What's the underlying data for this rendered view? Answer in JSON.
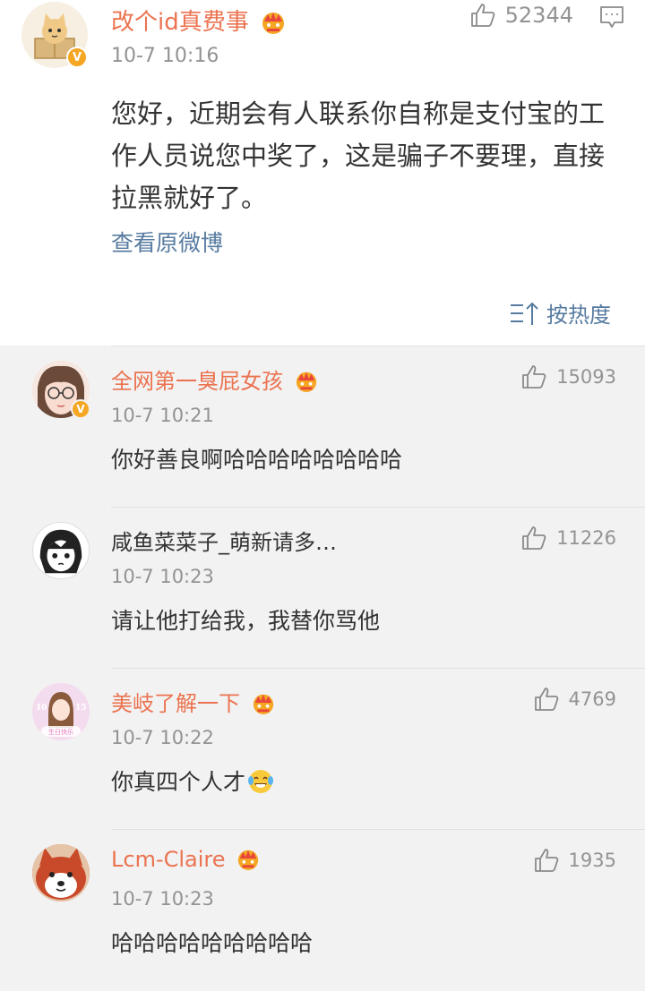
{
  "main_post": {
    "username": "改个id真费事",
    "time": "10-7 10:16",
    "likes": "52344",
    "text": "您好，近期会有人联系你自称是支付宝的工作人员说您中奖了，这是骗子不要理，直接拉黑就好了。",
    "view_original": "查看原微博",
    "sort_label": "按热度"
  },
  "comments": [
    {
      "username": "全网第一臭屁女孩",
      "time": "10-7 10:21",
      "likes": "15093",
      "text": "你好善良啊哈哈哈哈哈哈哈哈"
    },
    {
      "username": "咸鱼菜菜子_萌新请多…",
      "time": "10-7 10:23",
      "likes": "11226",
      "text": "请让他打给我，我替你骂他"
    },
    {
      "username": "美岐了解一下",
      "time": "10-7 10:22",
      "likes": "4769",
      "text": "你真四个人才"
    },
    {
      "username": "Lcm-Claire",
      "time": "10-7 10:23",
      "likes": "1935",
      "text": "哈哈哈哈哈哈哈哈哈"
    }
  ],
  "avatar_text": {
    "left": "10",
    "right": "15",
    "bottom": "生日快乐"
  },
  "colors": {
    "username": "#eb7350",
    "link": "#577ba0",
    "meta": "#939393",
    "crown": "#f5a623"
  },
  "icons": [
    "thumb-up-icon",
    "comment-icon",
    "sort-icon",
    "crown-icon",
    "verified-icon",
    "laugh-cry-emoji"
  ]
}
